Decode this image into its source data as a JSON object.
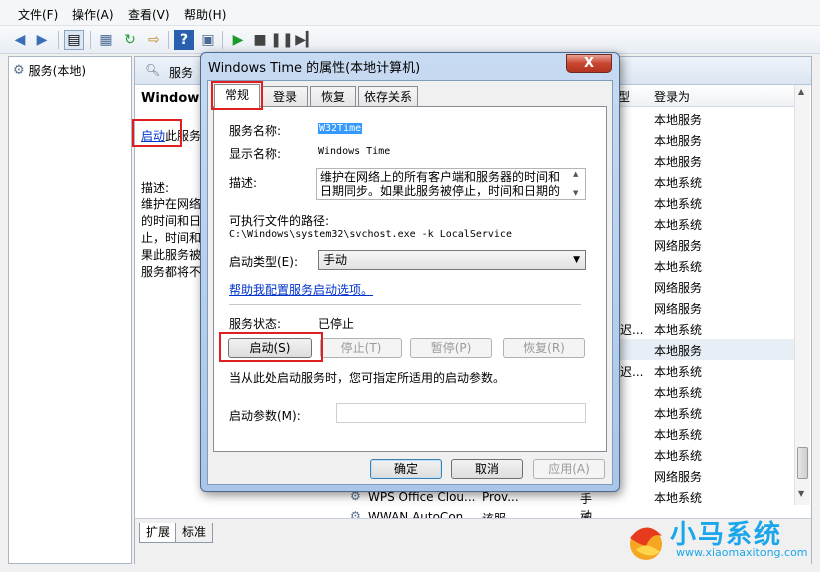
{
  "menu": [
    "文件(F)",
    "操作(A)",
    "查看(V)",
    "帮助(H)"
  ],
  "tree": {
    "root_label": "服务(本地)"
  },
  "right_header": {
    "title": "服务"
  },
  "extended": {
    "service_title": "Windows",
    "start_link": "启动",
    "start_suffix": "此服务",
    "desc_label": "描述:",
    "desc_lines": [
      "维护在网络",
      "的时间和日",
      "止，时间和",
      "果此服务被",
      "服务都将不"
    ]
  },
  "columns": {
    "type": "型",
    "logon": "登录为"
  },
  "rows": [
    {
      "type": "",
      "logon": "本地服务"
    },
    {
      "type": "",
      "logon": "本地服务"
    },
    {
      "type": "",
      "logon": "本地服务"
    },
    {
      "type": "",
      "logon": "本地系统"
    },
    {
      "type": "",
      "logon": "本地系统"
    },
    {
      "type": "",
      "logon": "本地系统"
    },
    {
      "type": "",
      "logon": "网络服务"
    },
    {
      "type": "",
      "logon": "本地系统"
    },
    {
      "type": "",
      "logon": "网络服务"
    },
    {
      "type": "",
      "logon": "网络服务"
    },
    {
      "type": "迟...",
      "logon": "本地系统"
    },
    {
      "type": "",
      "logon": "本地服务"
    },
    {
      "type": "迟...",
      "logon": "本地系统"
    },
    {
      "type": "",
      "logon": "本地系统"
    },
    {
      "type": "",
      "logon": "本地系统"
    },
    {
      "type": "",
      "logon": "本地系统"
    },
    {
      "type": "",
      "logon": "本地系统"
    },
    {
      "type": "",
      "logon": "网络服务"
    },
    {
      "type": "",
      "logon": "本地系统"
    }
  ],
  "bottom_rows": [
    {
      "name": "WPS Office Clou...",
      "desc": "Prov...",
      "startup": "手动"
    },
    {
      "name": "WWAN AutoCon...",
      "desc": "该服...",
      "startup": "手动"
    }
  ],
  "bottom_tabs": [
    "扩展",
    "标准"
  ],
  "dialog": {
    "title": "Windows Time 的属性(本地计算机)",
    "close": "X",
    "tabs": [
      "常规",
      "登录",
      "恢复",
      "依存关系"
    ],
    "service_name_label": "服务名称:",
    "service_name_value": "W32Time",
    "display_name_label": "显示名称:",
    "display_name_value": "Windows Time",
    "desc_label": "描述:",
    "desc_value": "维护在网络上的所有客户端和服务器的时间和日期同步。如果此服务被停止，时间和日期的",
    "path_label": "可执行文件的路径:",
    "path_value": "C:\\Windows\\system32\\svchost.exe -k LocalService",
    "startup_label": "启动类型(E):",
    "startup_value": "手动",
    "help_link": "帮助我配置服务启动选项。",
    "status_label": "服务状态:",
    "status_value": "已停止",
    "btn_start": "启动(S)",
    "btn_stop": "停止(T)",
    "btn_pause": "暂停(P)",
    "btn_resume": "恢复(R)",
    "hint": "当从此处启动服务时，您可指定所适用的启动参数。",
    "params_label": "启动参数(M):",
    "params_value": "",
    "btn_ok": "确定",
    "btn_cancel": "取消",
    "btn_apply": "应用(A)"
  },
  "logo": {
    "text": "小马系统",
    "url": "www.xiaomaxitong.com"
  },
  "colors": {
    "link": "#0033cc",
    "highlight": "#e02020",
    "selection": "#3399ff"
  }
}
